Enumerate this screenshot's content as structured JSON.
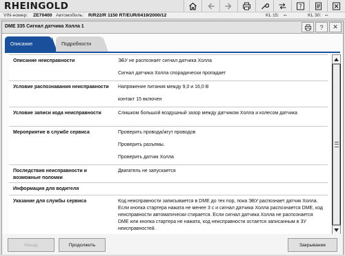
{
  "app": {
    "logo": "RHEINGOLD"
  },
  "vinbar": {
    "vin_label": "VIN-номер:",
    "vin_value": "ZE70400",
    "car_label": "Автомобиль:",
    "car_value": "R/R22/R 1150 RT/EUR/0419/2000/12",
    "kl15_label": "KL 15:",
    "kl15_value": "--",
    "kl30_label": "KL 30:",
    "kl30_value": "--"
  },
  "toolbar_icons": [
    "home-icon",
    "back-icon",
    "forward-icon",
    "print-icon",
    "wrench-icon",
    "transfer-icon",
    "help-icon",
    "notes-icon",
    "close-icon"
  ],
  "window": {
    "title": "DME 335 Сигнал датчика Холла 1",
    "help_glyph": "?",
    "close_glyph": "✕"
  },
  "tabs": [
    {
      "label": "Описание",
      "active": true
    },
    {
      "label": "Подробности",
      "active": false
    }
  ],
  "rows": [
    {
      "label": "Описание неисправности",
      "values": [
        "ЭБУ не распознает сигнал датчика Холла",
        "Сигнал датчика Холла спорадически пропадает"
      ]
    },
    {
      "label": "Условие распознавания неисправности",
      "values": [
        "Напряжение питания между 9,0 и 16,0 В",
        "контакт 15 включен"
      ]
    },
    {
      "label": "Условие записи кода неисправности",
      "values": [
        "Слишком большой воздушный зазор между датчиком Холла и колесом датчика"
      ]
    },
    {
      "label": "Мероприятие в службе сервиса",
      "values": [
        "Проверить провода/жгут проводов",
        "Проверить разъемы.",
        "Проверить датчик Холла"
      ]
    },
    {
      "label": "Последствия неисправности и возможные поломки",
      "values": [
        "Двигатель не запускается"
      ]
    },
    {
      "label": "Информация для водителя",
      "values": []
    },
    {
      "label": "Указание для службы сервиса",
      "values": [
        "Код неисправности записывается в DME до тех пор, пока ЭБУ распознает датчик Холла. Если кнопка стартера нажата не менее 3 с и сигнал датчика Холла распознается DME, код неисправности автоматически стирается. Если сигнал датчика Холла не распознается DME или кнопка стартера не нажата, код неисправности остается записанным в ЗУ неисправностей."
      ]
    }
  ],
  "footer": {
    "back_label": "Назад",
    "continue_label": "Продолжить",
    "close_label": "Закрывание"
  }
}
